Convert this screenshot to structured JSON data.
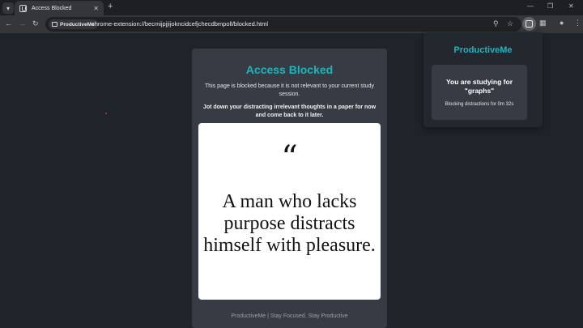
{
  "browser": {
    "tab_title": "Access Blocked",
    "new_tab_glyph": "+",
    "site_chip": "ProductiveMe",
    "url": "chrome-extension://becmijpjjijokncidcefjchecdbmpoll/blocked.html"
  },
  "page": {
    "title": "Access Blocked",
    "description": "This page is blocked because it is not relevant to your current study session.",
    "note": "Jot down your distracting irrelevant thoughts in a paper for now and come back to it later.",
    "quote_mark": "“",
    "quote": "A man who lacks purpose distracts himself with pleasure.",
    "footer": "ProductiveMe | Stay Focused, Stay Productive"
  },
  "popup": {
    "title": "ProductiveMe",
    "heading": "You are studying for \"graphs\"",
    "timer": "Blocking distractions for 0m 32s"
  },
  "colors": {
    "accent": "#1ab6be",
    "page_bg": "#1f232a",
    "card_bg": "#373c44"
  },
  "icons": [
    "tab-search-icon",
    "favicon-icon",
    "close-icon",
    "back-icon",
    "forward-icon",
    "reload-icon",
    "site-info-icon",
    "zoom-icon",
    "star-icon",
    "extension-icon",
    "puzzle-icon",
    "profile-icon",
    "menu-icon",
    "minimize-icon",
    "maximize-icon"
  ]
}
